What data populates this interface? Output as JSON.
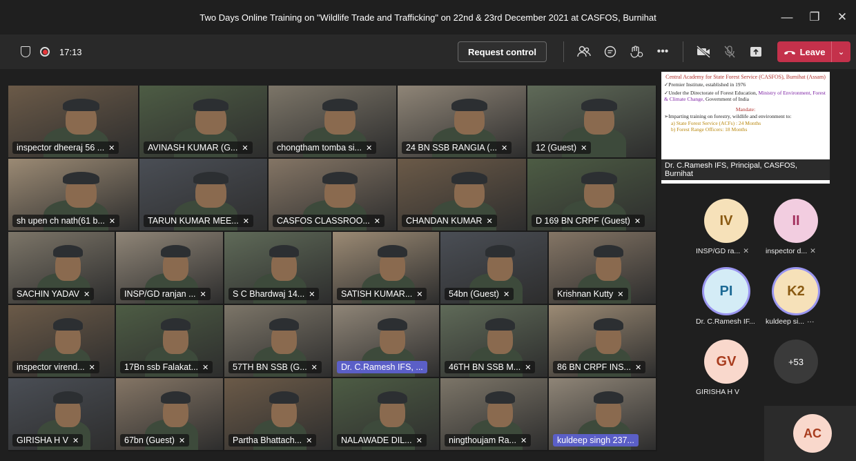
{
  "window": {
    "title": "Two Days Online Training on \"Wildlife Trade and Trafficking\" on 22nd & 23rd December 2021 at CASFOS, Burnihat"
  },
  "toolbar": {
    "timer": "17:13",
    "request_control": "Request control",
    "leave": "Leave",
    "icons": [
      "shield-icon",
      "recording-icon",
      "people-icon",
      "chat-icon",
      "reactions-icon",
      "more-icon",
      "camera-off-icon",
      "mic-off-icon",
      "share-icon",
      "phone-icon"
    ]
  },
  "participants": [
    {
      "name": "inspector dheeraj 56 ...",
      "muted": true
    },
    {
      "name": "AVINASH KUMAR (G...",
      "muted": true
    },
    {
      "name": "chongtham tomba si...",
      "muted": true
    },
    {
      "name": "24 BN SSB RANGIA (...",
      "muted": true
    },
    {
      "name": "12 (Guest)",
      "muted": true
    },
    {
      "name": "sh upen ch nath(61 b...",
      "muted": true
    },
    {
      "name": "TARUN KUMAR MEE...",
      "muted": true
    },
    {
      "name": "CASFOS CLASSROO...",
      "muted": true
    },
    {
      "name": "CHANDAN KUMAR",
      "muted": true
    },
    {
      "name": "D 169 BN CRPF (Guest)",
      "muted": true
    },
    {
      "name": "SACHIN YADAV",
      "muted": true
    },
    {
      "name": "INSP/GD ranjan ...",
      "muted": true
    },
    {
      "name": "S C Bhardwaj 14...",
      "muted": true
    },
    {
      "name": "SATISH KUMAR...",
      "muted": true
    },
    {
      "name": "54bn (Guest)",
      "muted": true
    },
    {
      "name": "Krishnan Kutty",
      "muted": true
    },
    {
      "name": "inspector virend...",
      "muted": true
    },
    {
      "name": "17Bn ssb Falakat...",
      "muted": true
    },
    {
      "name": "57TH BN SSB (G...",
      "muted": true
    },
    {
      "name": "Dr. C.Ramesh IFS, ...",
      "muted": false,
      "speaking": true
    },
    {
      "name": "46TH BN SSB M...",
      "muted": true
    },
    {
      "name": "86 BN CRPF INS...",
      "muted": true
    },
    {
      "name": "GIRISHA H V",
      "muted": true
    },
    {
      "name": "67bn (Guest)",
      "muted": true
    },
    {
      "name": "Partha Bhattach...",
      "muted": true
    },
    {
      "name": "NALAWADE DIL...",
      "muted": true
    },
    {
      "name": "ningthoujam Ra...",
      "muted": true
    },
    {
      "name": "kuldeep singh 237...",
      "muted": false,
      "speaking": true
    }
  ],
  "shared": {
    "title": "Central Academy for State Forest Service (CASFOS), Burnihat (Assam)",
    "line1": "✓Premier Institute, established in 1976",
    "line2a": "✓Under the Directorate of Forest Education, ",
    "line2b": "Ministry of Environment, Forest & Climate Change,",
    "line2c": " Government of India",
    "mandate": "Mandate:",
    "line3": "➢Imparting training on forestry, wildlife and environment to:",
    "opt1": "a) State Forest Service (ACFs) : 24 Months",
    "opt2": "b) Forest Range Officers: 18 Months",
    "presenter": "Dr. C.Ramesh IFS, Principal, CASFOS, Burnihat"
  },
  "roster": [
    {
      "initials": "IV",
      "name": "INSP/GD ra...",
      "bg": "#f6e1b9",
      "fg": "#8a5a12",
      "muted": true
    },
    {
      "initials": "II",
      "name": "inspector d...",
      "bg": "#f2cde0",
      "fg": "#a3305e",
      "muted": true
    },
    {
      "initials": "PI",
      "name": "Dr. C.Ramesh IF...",
      "bg": "#d4ecf6",
      "fg": "#1d6a95",
      "muted": false
    },
    {
      "initials": "K2",
      "name": "kuldeep si...",
      "bg": "#f6e1b9",
      "fg": "#8a5a12",
      "muted": false,
      "more": "···"
    },
    {
      "initials": "GV",
      "name": "GIRISHA H V",
      "bg": "#f9d8cc",
      "fg": "#a83c1e",
      "muted": false
    },
    {
      "initials": "+53",
      "name": "",
      "bg": "#3a3a3a",
      "fg": "#ffffff",
      "muted": false
    }
  ],
  "self_view": {
    "initials": "AC",
    "bg": "#f9d8cc",
    "fg": "#a83c1e"
  }
}
